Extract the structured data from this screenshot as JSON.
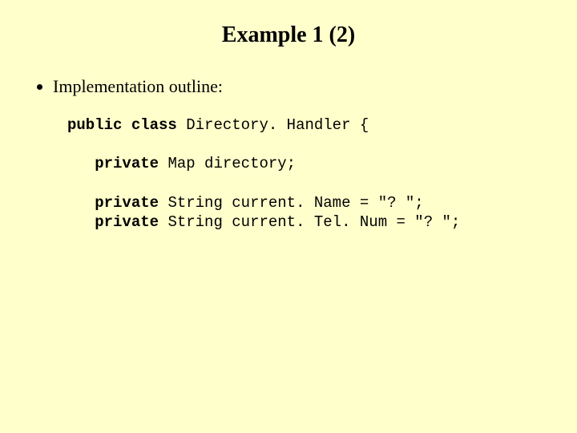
{
  "title": "Example 1 (2)",
  "bullet": "Implementation outline:",
  "code": {
    "kw_public": "public",
    "kw_class": "class",
    "cls_name": " Directory. Handler {",
    "kw_private1": "private",
    "line1_rest": " Map directory;",
    "kw_private2": "private",
    "line2_rest": " String current. Name = \"? \";",
    "kw_private3": "private",
    "line3_rest": " String current. Tel. Num = \"? \";"
  }
}
